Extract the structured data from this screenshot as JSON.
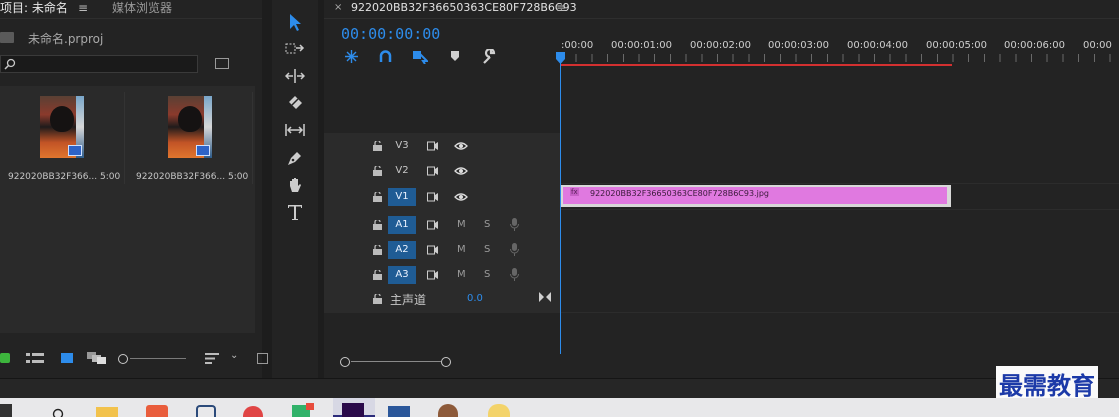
{
  "project_panel": {
    "tab_project": "项目: 未命名",
    "tab_media": "媒体浏览器",
    "project_file": "未命名.prproj",
    "items": [
      {
        "name": "922020BB32F366...",
        "duration": "5:00"
      },
      {
        "name": "922020BB32F366...",
        "duration": "5:00"
      }
    ]
  },
  "timeline": {
    "tab_title": "922020BB32F36650363CE80F728B6C93",
    "timecode": "00:00:00:00",
    "ruler_ticks": [
      ":00:00",
      "00:00:01:00",
      "00:00:02:00",
      "00:00:03:00",
      "00:00:04:00",
      "00:00:05:00",
      "00:00:06:00",
      "00:00"
    ],
    "video_tracks": [
      "V3",
      "V2",
      "V1"
    ],
    "audio_tracks": [
      "A1",
      "A2",
      "A3"
    ],
    "mute_label": "M",
    "solo_label": "S",
    "master_label": "主声道",
    "master_value": "0.0",
    "clip_name": "922020BB32F36650363CE80F728B6C93.jpg",
    "clip_fx": "fx"
  },
  "watermark": "最需教育",
  "colors": {
    "accent_blue": "#2d8ceb",
    "track_active": "#1f5c95",
    "clip_pink": "#e079e0",
    "work_area_red": "#d33030"
  }
}
